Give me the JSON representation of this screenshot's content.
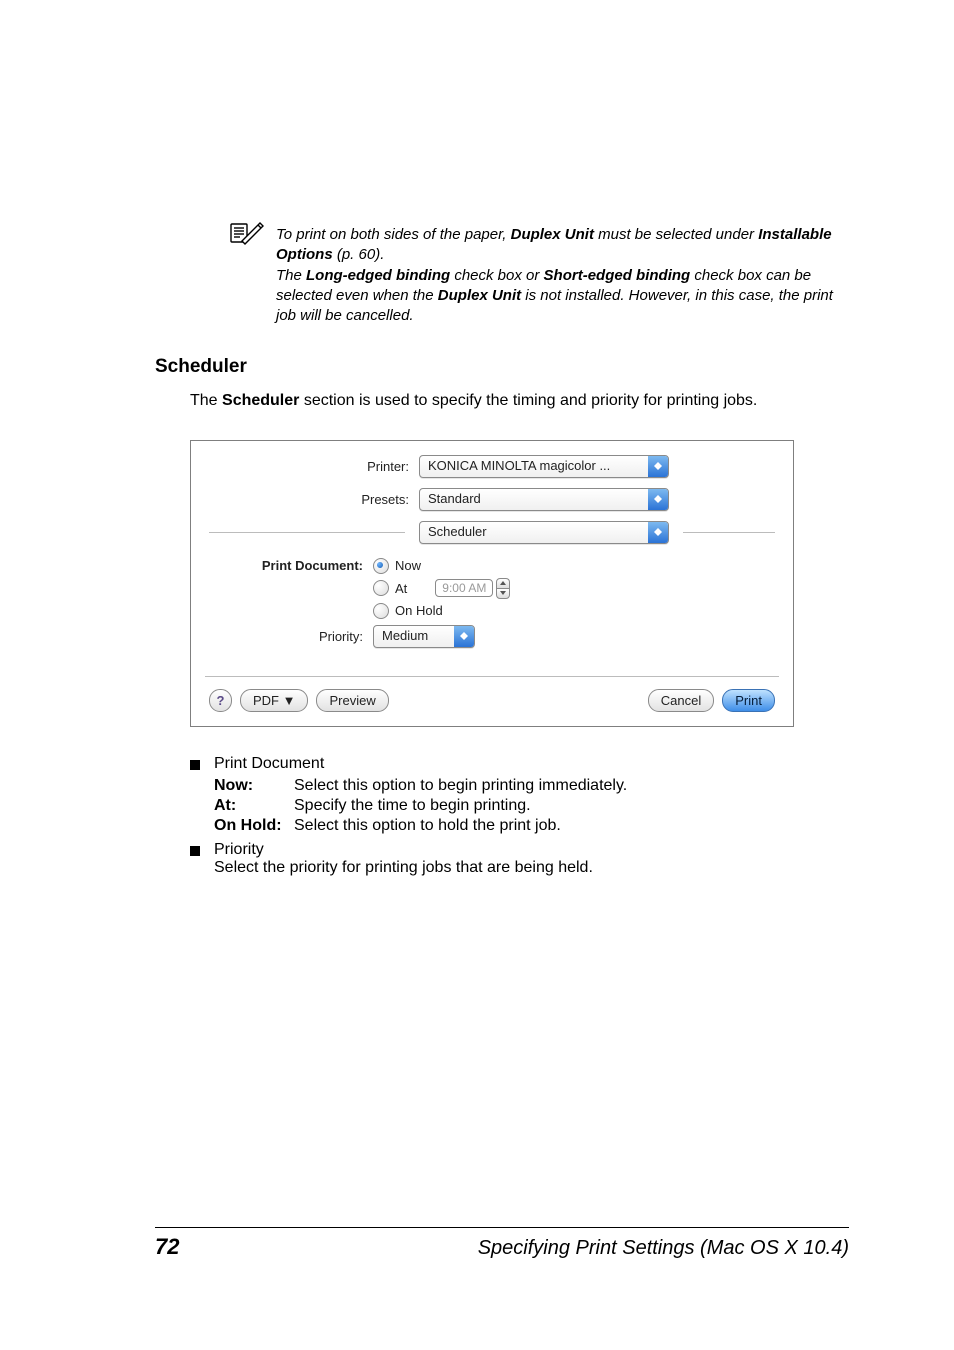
{
  "note": {
    "line1a": "To print on both sides of the paper, ",
    "duplex": "Duplex Unit",
    "line1b": " must be selected under ",
    "installable": "Installable Options",
    "pageref": " (p. 60).",
    "line2a": "The ",
    "longedge": "Long-edged binding",
    "line2b": " check box or ",
    "shortedge": "Short-edged binding",
    "line2c": " check box can be selected even when the ",
    "line2d": " is not installed. However, in this case, the print job will be cancelled."
  },
  "heading": "Scheduler",
  "intro_a": "The ",
  "intro_b": "Scheduler",
  "intro_c": " section is used to specify the timing and priority for printing jobs.",
  "dialog": {
    "printer_label": "Printer:",
    "printer_value": "KONICA MINOLTA magicolor ...",
    "presets_label": "Presets:",
    "presets_value": "Standard",
    "panel_value": "Scheduler",
    "print_document_label": "Print Document:",
    "opt_now": "Now",
    "opt_at": "At",
    "opt_hold": "On Hold",
    "time_value": "9:00 AM",
    "priority_label": "Priority:",
    "priority_value": "Medium",
    "help": "?",
    "pdf": "PDF ▼",
    "preview": "Preview",
    "cancel": "Cancel",
    "print": "Print"
  },
  "bullets": {
    "print_document": "Print Document",
    "now_term": "Now",
    "now_desc": "Select this option to begin printing immediately.",
    "at_term": "At",
    "at_desc": "Specify the time to begin printing.",
    "hold_term": "On Hold",
    "hold_desc": "Select this option to hold the print job.",
    "priority": "Priority",
    "priority_desc": "Select the priority for printing jobs that are being held."
  },
  "footer": {
    "page": "72",
    "title": "Specifying Print Settings (Mac OS X 10.4)"
  }
}
